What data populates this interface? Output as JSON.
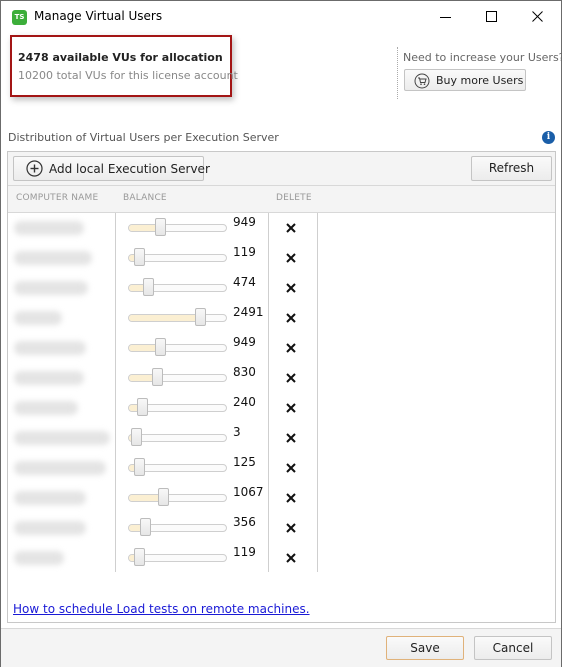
{
  "window": {
    "app_icon_text": "TS",
    "title": "Manage Virtual Users",
    "controls": [
      "minimize",
      "maximize",
      "close"
    ]
  },
  "license": {
    "available": "2478 available VUs for allocation",
    "total": "10200 total VUs for this license account"
  },
  "buy": {
    "prompt": "Need to increase your Users?",
    "button_label": "Buy more Users"
  },
  "distribution_label": "Distribution of Virtual Users per Execution Server",
  "toolbar": {
    "add_label": "Add local Execution Server",
    "refresh_label": "Refresh"
  },
  "columns": {
    "name": "COMPUTER NAME",
    "balance": "BALANCE",
    "delete": "DELETE"
  },
  "servers": [
    {
      "name": "",
      "balance": 949,
      "max": 10200
    },
    {
      "name": "",
      "balance": 119,
      "max": 10200
    },
    {
      "name": "",
      "balance": 474,
      "max": 10200
    },
    {
      "name": "",
      "balance": 2491,
      "max": 10200
    },
    {
      "name": "",
      "balance": 949,
      "max": 10200
    },
    {
      "name": "",
      "balance": 830,
      "max": 10200
    },
    {
      "name": "",
      "balance": 240,
      "max": 10200
    },
    {
      "name": "",
      "balance": 3,
      "max": 10200
    },
    {
      "name": "",
      "balance": 125,
      "max": 10200
    },
    {
      "name": "",
      "balance": 1067,
      "max": 10200
    },
    {
      "name": "",
      "balance": 356,
      "max": 10200
    },
    {
      "name": "",
      "balance": 119,
      "max": 10200
    }
  ],
  "help_link": "How to schedule Load tests on remote machines.",
  "footer": {
    "save_label": "Save",
    "cancel_label": "Cancel"
  },
  "colors": {
    "license_border": "#a31515",
    "link": "#1a1ad6",
    "info": "#1a5ea8",
    "slider_fill": "#fbefd2",
    "save_border": "#e0b27a"
  }
}
